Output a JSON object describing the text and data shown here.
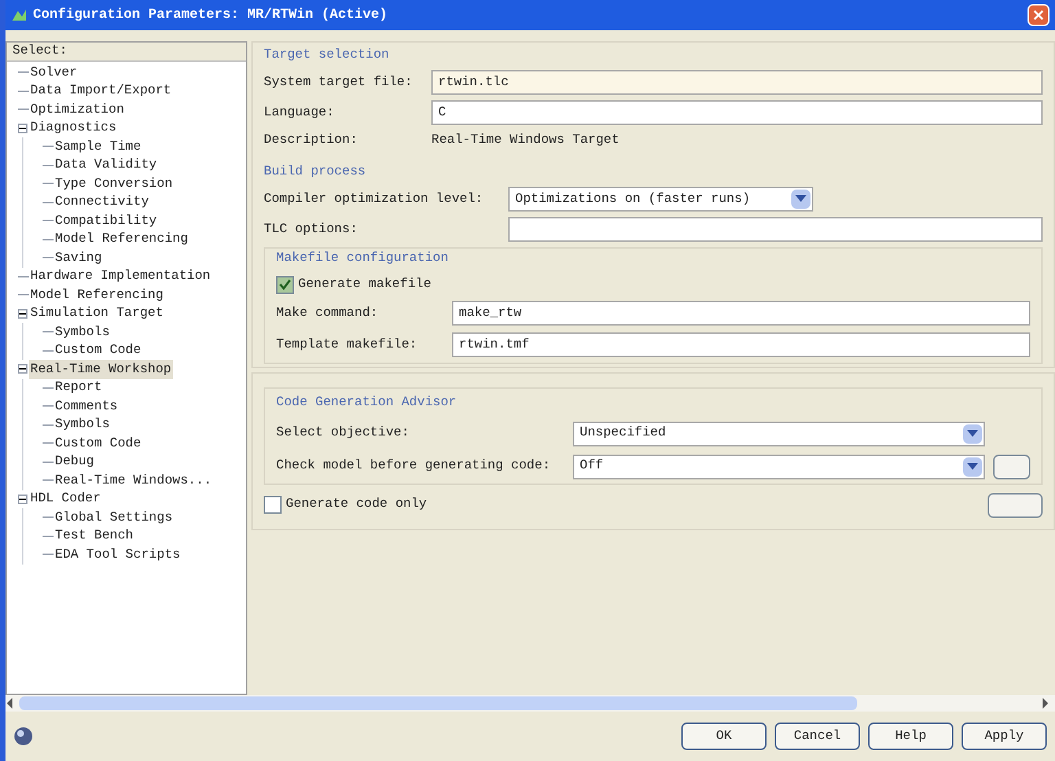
{
  "window": {
    "title": "Configuration Parameters: MR/RTWin (Active)"
  },
  "sidebar": {
    "header": "Select:",
    "items": [
      {
        "label": "Solver",
        "selected": false
      },
      {
        "label": "Data Import/Export",
        "selected": false
      },
      {
        "label": "Optimization",
        "selected": false
      },
      {
        "label": "Diagnostics",
        "selected": false,
        "expanded": true,
        "children": [
          {
            "label": "Sample Time",
            "selected": false
          },
          {
            "label": "Data Validity",
            "selected": false
          },
          {
            "label": "Type Conversion",
            "selected": false
          },
          {
            "label": "Connectivity",
            "selected": false
          },
          {
            "label": "Compatibility",
            "selected": false
          },
          {
            "label": "Model Referencing",
            "selected": false
          },
          {
            "label": "Saving",
            "selected": false
          }
        ]
      },
      {
        "label": "Hardware Implementation",
        "selected": false
      },
      {
        "label": "Model Referencing",
        "selected": false
      },
      {
        "label": "Simulation Target",
        "selected": false,
        "expanded": true,
        "children": [
          {
            "label": "Symbols",
            "selected": false
          },
          {
            "label": "Custom Code",
            "selected": false
          }
        ]
      },
      {
        "label": "Real-Time Workshop",
        "selected": true,
        "expanded": true,
        "children": [
          {
            "label": "Report",
            "selected": false
          },
          {
            "label": "Comments",
            "selected": false
          },
          {
            "label": "Symbols",
            "selected": false
          },
          {
            "label": "Custom Code",
            "selected": false
          },
          {
            "label": "Debug",
            "selected": false
          },
          {
            "label": "Real-Time Windows...",
            "selected": false
          }
        ]
      },
      {
        "label": "HDL Coder",
        "selected": false,
        "expanded": true,
        "children": [
          {
            "label": "Global Settings",
            "selected": false
          },
          {
            "label": "Test Bench",
            "selected": false
          },
          {
            "label": "EDA Tool Scripts",
            "selected": false
          }
        ]
      }
    ]
  },
  "target_selection": {
    "title": "Target selection",
    "system_target_file": {
      "label": "System target file:",
      "value": "rtwin.tlc"
    },
    "language": {
      "label": "Language:",
      "value": "C"
    },
    "description": {
      "label": "Description:",
      "value": "Real-Time Windows Target"
    }
  },
  "build_process": {
    "title": "Build process",
    "compiler_optimization": {
      "label": "Compiler optimization level:",
      "value": "Optimizations on (faster runs)"
    },
    "tlc_options": {
      "label": "TLC options:"
    },
    "makefile": {
      "title": "Makefile configuration",
      "generate_makefile": {
        "label": "Generate makefile",
        "checked": true
      },
      "make_command": {
        "label": "Make command:",
        "value": "make_rtw"
      },
      "template_makefile": {
        "label": "Template makefile:",
        "value": "rtwin.tmf"
      }
    }
  },
  "advisor": {
    "title": "Code Generation Advisor",
    "select_objective": {
      "label": "Select objective:",
      "value": "Unspecified"
    },
    "check_model": {
      "label": "Check model before generating code:",
      "value": "Off"
    }
  },
  "generate_code_only": {
    "label": "Generate code only",
    "checked": false
  },
  "buttons": [
    "OK",
    "Cancel",
    "Help",
    "Apply"
  ]
}
